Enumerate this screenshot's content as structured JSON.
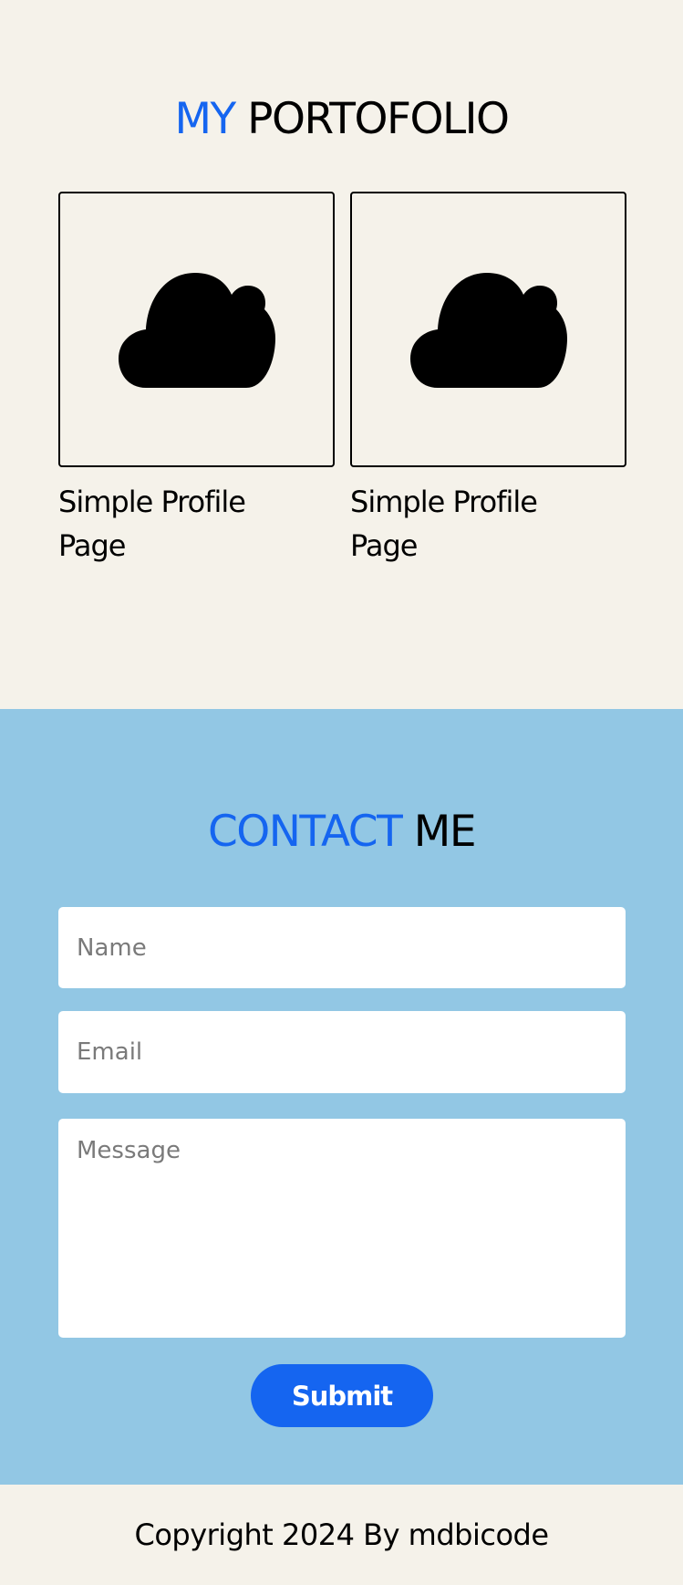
{
  "portfolio": {
    "title_accent": "MY",
    "title_rest": "PORTOFOLIO",
    "cards": [
      {
        "title": "Simple Profile Page",
        "icon": "cloud-icon"
      },
      {
        "title": "Simple Profile Page",
        "icon": "cloud-icon"
      }
    ]
  },
  "contact": {
    "title_accent": "CONTACT",
    "title_rest": "ME",
    "name_placeholder": "Name",
    "email_placeholder": "Email",
    "message_placeholder": "Message",
    "submit_label": "Submit"
  },
  "footer": {
    "copyright": "Copyright 2024 By mdbicode"
  },
  "colors": {
    "accent": "#1565f0",
    "page_bg": "#f5f2ea",
    "contact_bg": "#92c7e4"
  }
}
